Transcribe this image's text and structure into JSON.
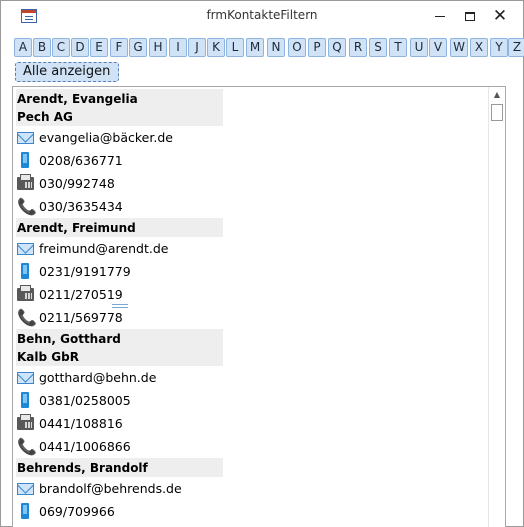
{
  "window": {
    "title": "frmKontakteFiltern",
    "icon": "form-icon",
    "controls": {
      "minimize": "minimize-icon",
      "maximize": "maximize-icon",
      "close": "✕"
    }
  },
  "letters": [
    "A",
    "B",
    "C",
    "D",
    "E",
    "F",
    "G",
    "H",
    "I",
    "J",
    "K",
    "L",
    "M",
    "N",
    "O",
    "P",
    "Q",
    "R",
    "S",
    "T",
    "U",
    "V",
    "W",
    "X",
    "Y",
    "Z"
  ],
  "show_all_label": "Alle anzeigen",
  "contacts": [
    {
      "name": "Arendt, Evangelia",
      "company": "Pech AG",
      "email": "evangelia@bäcker.de",
      "mobile": "0208/636771",
      "fax": "030/992748",
      "phone": "030/3635434"
    },
    {
      "name": "Arendt, Freimund",
      "company": "",
      "email": "freimund@arendt.de",
      "mobile": "0231/9191779",
      "fax": "0211/270519",
      "phone": "0211/569778"
    },
    {
      "name": "Behn, Gotthard",
      "company": "Kalb GbR",
      "email": "gotthard@behn.de",
      "mobile": "0381/0258005",
      "fax": "0441/108816",
      "phone": "0441/1006866"
    },
    {
      "name": "Behrends, Brandolf",
      "company": "",
      "email": "brandolf@behrends.de",
      "mobile": "069/709966",
      "fax": "",
      "phone": ""
    }
  ],
  "colors": {
    "button_bg": "#cfe2f6",
    "button_border": "#8fb4de",
    "header_bg": "#eeeeee",
    "icon_blue": "#1f88d6"
  }
}
